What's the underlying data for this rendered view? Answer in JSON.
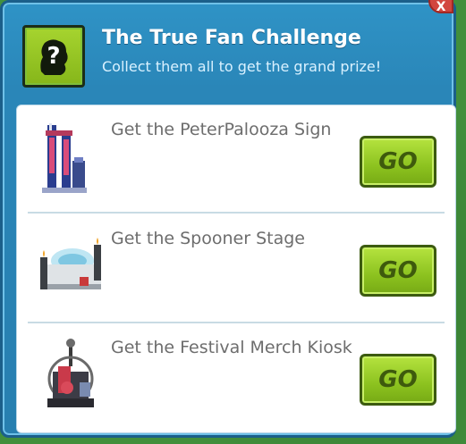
{
  "dialog": {
    "title": "The True Fan Challenge",
    "subtitle": "Collect them all to get the grand prize!",
    "close_label": "X"
  },
  "items": [
    {
      "label": "Get the PeterPalooza Sign",
      "button": "GO",
      "icon": "peterpalooza-sign-icon"
    },
    {
      "label": "Get the Spooner Stage",
      "button": "GO",
      "icon": "spooner-stage-icon"
    },
    {
      "label": "Get the Festival Merch Kiosk",
      "button": "GO",
      "icon": "festival-merch-kiosk-icon"
    }
  ],
  "colors": {
    "dialog_blue": "#2a86b8",
    "button_green": "#8cc21f",
    "text_gray": "#6d6d6d"
  }
}
